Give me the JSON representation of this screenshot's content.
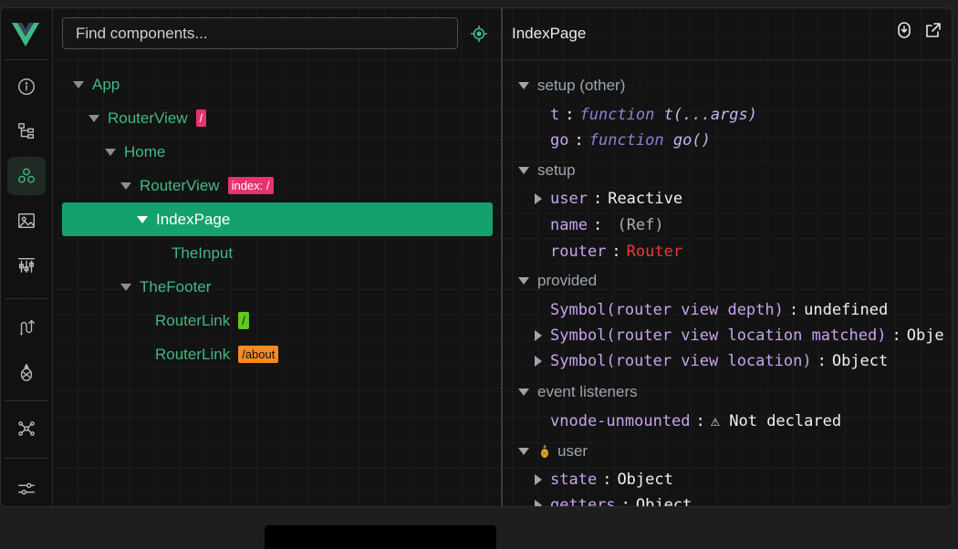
{
  "search": {
    "placeholder": "Find components..."
  },
  "sidebar": {
    "items": [
      {
        "name": "info",
        "icon": "info-icon"
      },
      {
        "name": "component-tree",
        "icon": "tree-icon"
      },
      {
        "name": "components",
        "icon": "components-icon",
        "active": true
      },
      {
        "name": "assets",
        "icon": "image-icon"
      },
      {
        "name": "timeline",
        "icon": "timeline-icon"
      },
      {
        "name": "routes",
        "icon": "route-icon"
      },
      {
        "name": "pinia",
        "icon": "pineapple-icon"
      },
      {
        "name": "graph",
        "icon": "graph-icon"
      },
      {
        "name": "settings",
        "icon": "settings-icon"
      }
    ]
  },
  "tree": [
    {
      "label": "App",
      "depth": 0,
      "expanded": true
    },
    {
      "label": "RouterView",
      "depth": 1,
      "expanded": true,
      "tag": "/",
      "tag_color": "#e5336f"
    },
    {
      "label": "Home",
      "depth": 2,
      "expanded": true
    },
    {
      "label": "RouterView",
      "depth": 3,
      "expanded": true,
      "tag": "index: /",
      "tag_color": "#e5336f"
    },
    {
      "label": "IndexPage",
      "depth": 4,
      "expanded": true,
      "selected": true
    },
    {
      "label": "TheInput",
      "depth": 5
    },
    {
      "label": "TheFooter",
      "depth": 3,
      "expanded": true
    },
    {
      "label": "RouterLink",
      "depth": 4,
      "tag": "/",
      "tag_color": "#61c81e"
    },
    {
      "label": "RouterLink",
      "depth": 4,
      "tag": "/about",
      "tag_color": "#f48b22"
    }
  ],
  "inspector": {
    "title": "IndexPage",
    "sections": {
      "setup_other": "setup (other)",
      "setup": "setup",
      "provided": "provided",
      "event_listeners": "event listeners",
      "user_store": "user"
    },
    "props": {
      "t_key": "t",
      "t_kw": "function",
      "t_sig": "t(...args)",
      "go_key": "go",
      "go_kw": "function",
      "go_sig": "go()",
      "user_key": "user",
      "user_val": "Reactive",
      "name_key": "name",
      "name_val": "(Ref)",
      "router_key": "router",
      "router_val": "Router",
      "depth_key": "Symbol(router view depth)",
      "depth_val": "undefined",
      "matched_key": "Symbol(router view location matched)",
      "matched_val": "Obje",
      "location_key": "Symbol(router view location)",
      "location_val": "Object",
      "vnode_key": "vnode-unmounted",
      "vnode_val": "⚠ Not declared",
      "state_key": "state",
      "state_val": "Object",
      "getters_key": "getters",
      "getters_val": "Object"
    },
    "colors": {
      "accent": "#41b883",
      "selected": "#15a16b",
      "prop_key": "#c8a4ef",
      "error": "#ea3a3a"
    }
  }
}
